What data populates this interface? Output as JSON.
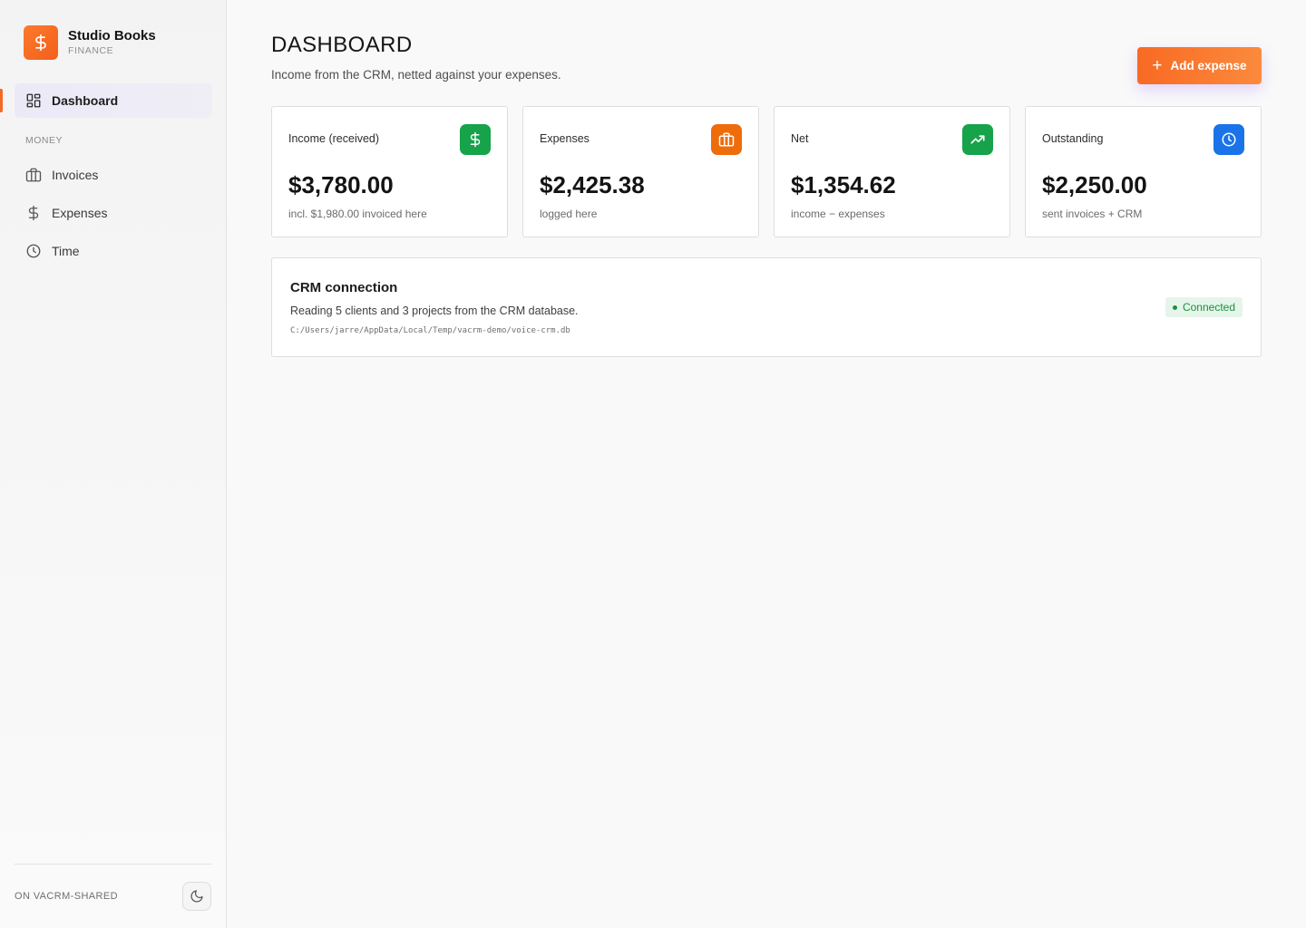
{
  "brand": {
    "name": "Studio Books",
    "subtitle": "FINANCE",
    "logo_icon": "dollar-icon",
    "logo_color": "#f86a24"
  },
  "nav": {
    "dashboard": {
      "label": "Dashboard",
      "icon": "grid-icon",
      "active": true
    },
    "section_label": "MONEY",
    "items": [
      {
        "label": "Invoices",
        "icon": "briefcase-icon"
      },
      {
        "label": "Expenses",
        "icon": "dollar-icon"
      },
      {
        "label": "Time",
        "icon": "clock-icon"
      }
    ]
  },
  "footer": {
    "label": "ON VACRM-SHARED",
    "theme_toggle_icon": "moon-icon"
  },
  "header": {
    "title": "DASHBOARD",
    "subtitle": "Income from the CRM, netted against your expenses.",
    "add_button_label": "Add expense"
  },
  "cards": [
    {
      "label": "Income (received)",
      "value": "$3,780.00",
      "note": "incl. $1,980.00 invoiced here",
      "icon": "dollar-icon",
      "color": "#16a34a"
    },
    {
      "label": "Expenses",
      "value": "$2,425.38",
      "note": "logged here",
      "icon": "briefcase-icon",
      "color": "#ef6c0b"
    },
    {
      "label": "Net",
      "value": "$1,354.62",
      "note": "income − expenses",
      "icon": "trending-up-icon",
      "color": "#16a34a"
    },
    {
      "label": "Outstanding",
      "value": "$2,250.00",
      "note": "sent invoices + CRM",
      "icon": "clock-icon",
      "color": "#1a73e8"
    }
  ],
  "crm": {
    "title": "CRM connection",
    "description": "Reading 5 clients and 3 projects from the CRM database.",
    "path": "C:/Users/jarre/AppData/Local/Temp/vacrm-demo/voice-crm.db",
    "status": "Connected",
    "status_color": "#19913e"
  },
  "accent_color": "#f36a23"
}
